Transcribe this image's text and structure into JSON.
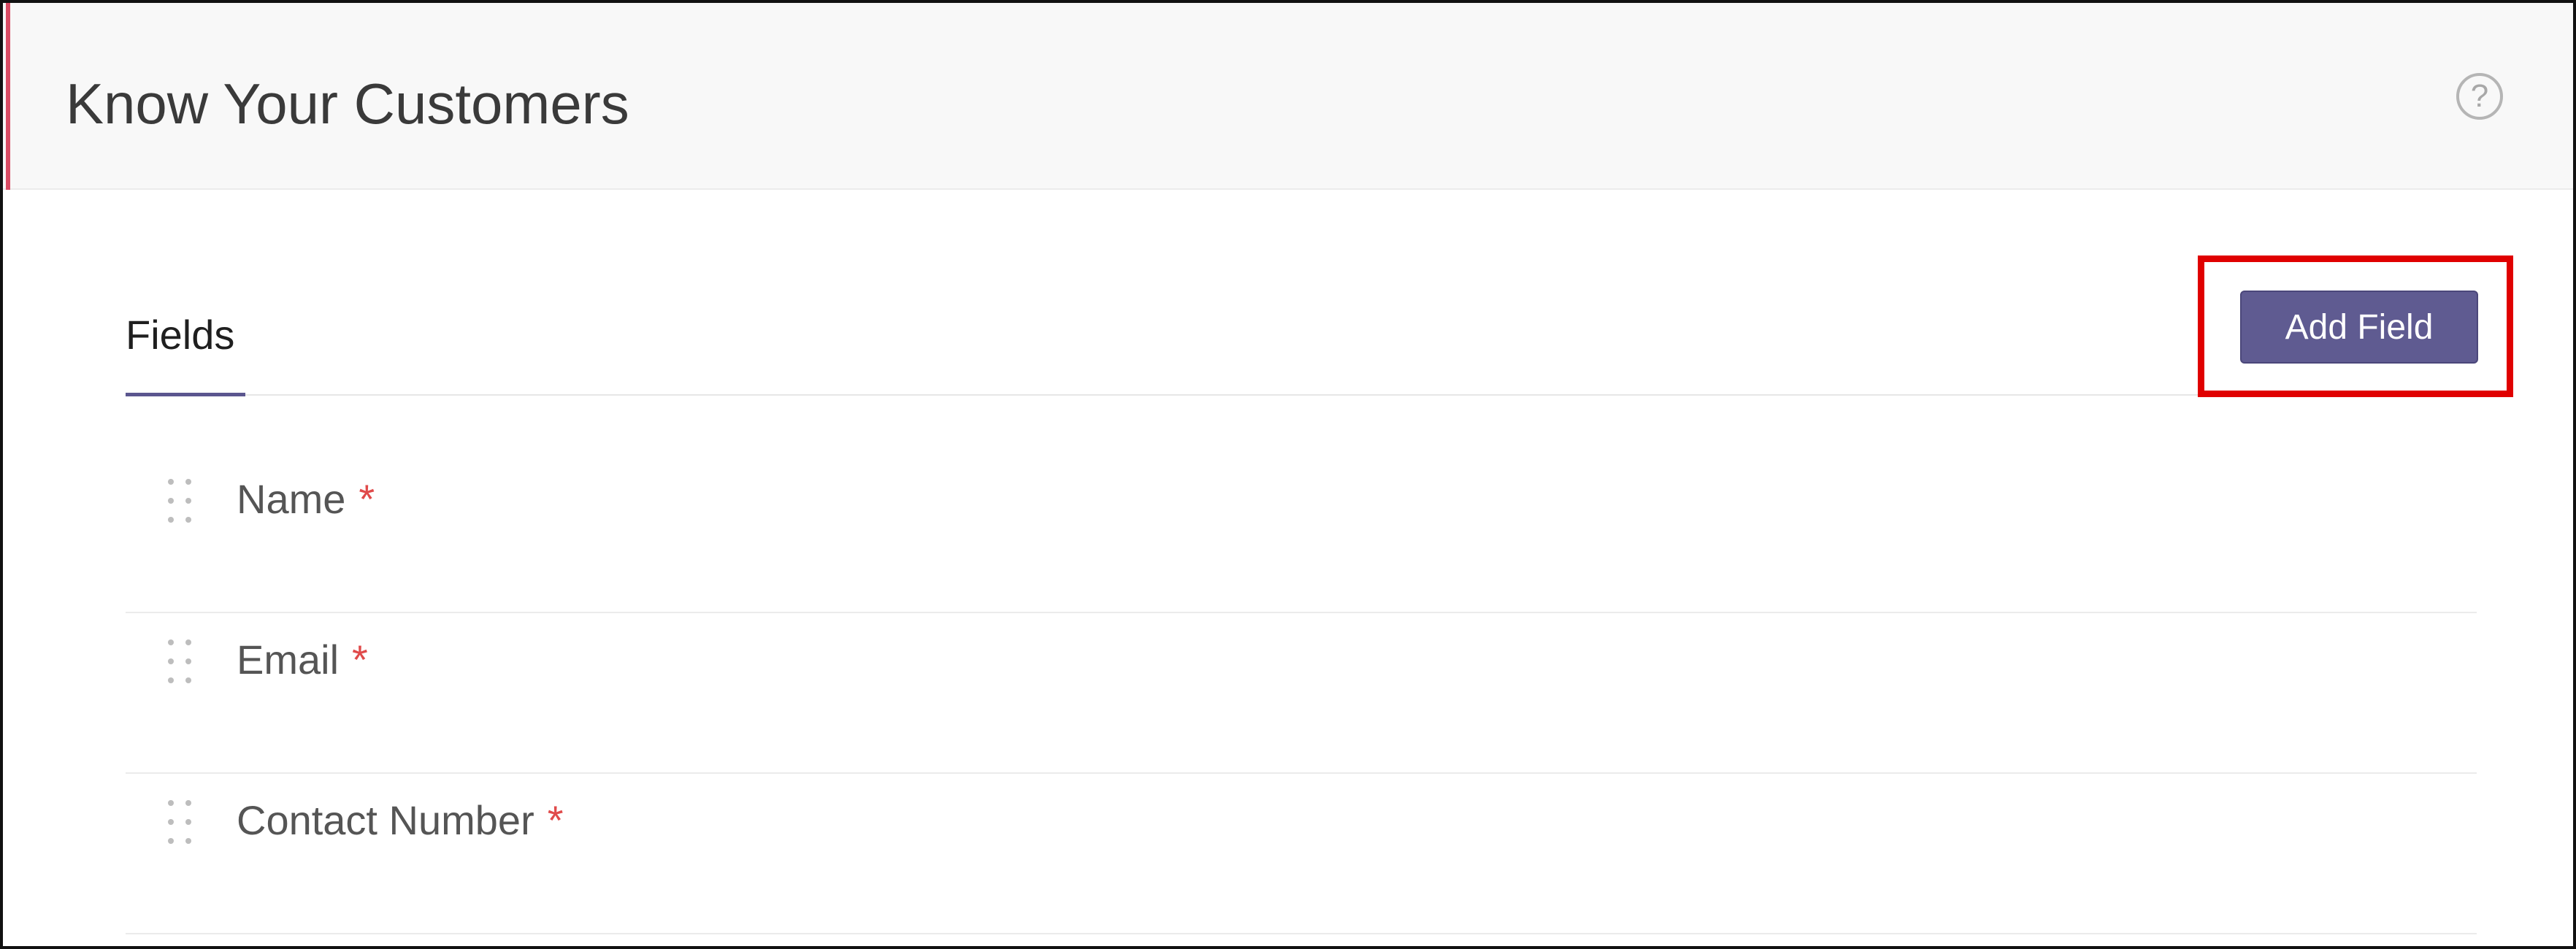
{
  "page": {
    "title": "Know Your Customers",
    "help_icon": "question-circle-icon"
  },
  "tabs": [
    {
      "label": "Fields",
      "active": true
    }
  ],
  "toolbar": {
    "add_field_label": "Add Field",
    "highlighted": true
  },
  "fields": [
    {
      "label": "Name",
      "required_mark": "*"
    },
    {
      "label": "Email",
      "required_mark": "*"
    },
    {
      "label": "Contact Number",
      "required_mark": "*"
    }
  ],
  "colors": {
    "accent": "#d94b63",
    "primary_button": "#5f5b91",
    "highlight": "#e00000",
    "required": "#e04a4a"
  }
}
